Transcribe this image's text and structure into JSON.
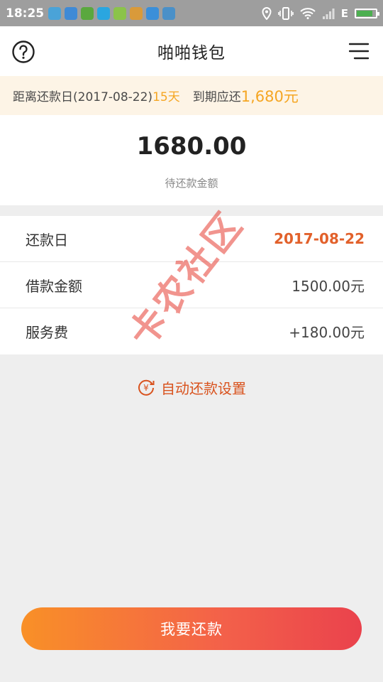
{
  "status_bar": {
    "time": "18:25",
    "network": "E",
    "battery_level": 0.85,
    "app_icons": [
      {
        "name": "headphone-app-icon",
        "color": "#4aa3d8"
      },
      {
        "name": "wechat-app-icon",
        "color": "#3f8ad6"
      },
      {
        "name": "browser-app-icon",
        "color": "#5aa83e"
      },
      {
        "name": "alipay-app-icon",
        "color": "#2aa6e0"
      },
      {
        "name": "game-app-icon",
        "color": "#8bc34a"
      },
      {
        "name": "weather-app-icon",
        "color": "#d99a3a"
      },
      {
        "name": "gallery-app-icon",
        "color": "#3b8fd9"
      },
      {
        "name": "usb-app-icon",
        "color": "#4a90c8"
      }
    ]
  },
  "header": {
    "title": "啪啪钱包"
  },
  "notice": {
    "prefix": "距离还款日(2017-08-22)",
    "days": "15天",
    "due_label": "到期应还",
    "due_amount": "1,680元"
  },
  "amount": {
    "value": "1680.00",
    "label": "待还款金额"
  },
  "details": [
    {
      "label": "还款日",
      "value": "2017-08-22"
    },
    {
      "label": "借款金额",
      "value": "1500.00元"
    },
    {
      "label": "服务费",
      "value": "+180.00元"
    }
  ],
  "auto_repay": {
    "label": "自动还款设置"
  },
  "watermark": {
    "text": "卡农社区"
  },
  "repay_button": {
    "label": "我要还款"
  },
  "colors": {
    "accent_orange": "#f5a623",
    "date_red": "#e2612b",
    "button_start": "#f99027",
    "button_end": "#ea424c"
  }
}
